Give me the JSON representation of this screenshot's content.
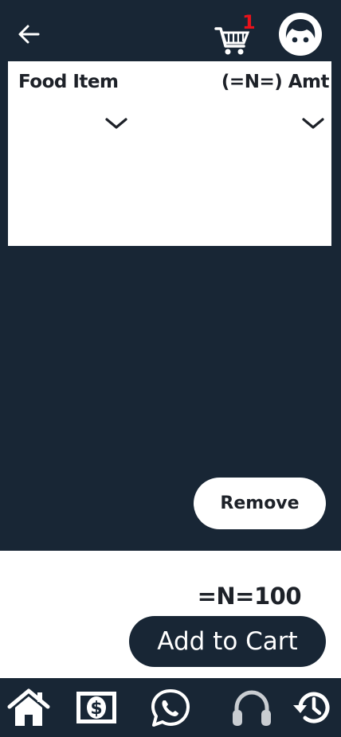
{
  "header": {
    "back_icon": "arrow-left-icon",
    "cart_icon": "cart-icon",
    "cart_count": "1",
    "avatar_icon": "face-avatar-icon"
  },
  "order_form": {
    "food_header": "Food Item",
    "amount_header": "(=N=) Amt",
    "food_dropdown_icon": "chevron-down-icon",
    "amount_dropdown_icon": "chevron-down-icon"
  },
  "actions": {
    "remove_label": "Remove",
    "total": "=N=100",
    "add_to_cart_label": "Add to Cart"
  },
  "bottom_nav": [
    {
      "icon": "home-icon"
    },
    {
      "icon": "money-icon"
    },
    {
      "icon": "whatsapp-icon"
    },
    {
      "icon": "headphones-icon"
    },
    {
      "icon": "history-icon"
    }
  ],
  "colors": {
    "background": "#182635",
    "panel": "#ffffff",
    "badge": "#e8121b",
    "text_dark": "#1d2128"
  }
}
